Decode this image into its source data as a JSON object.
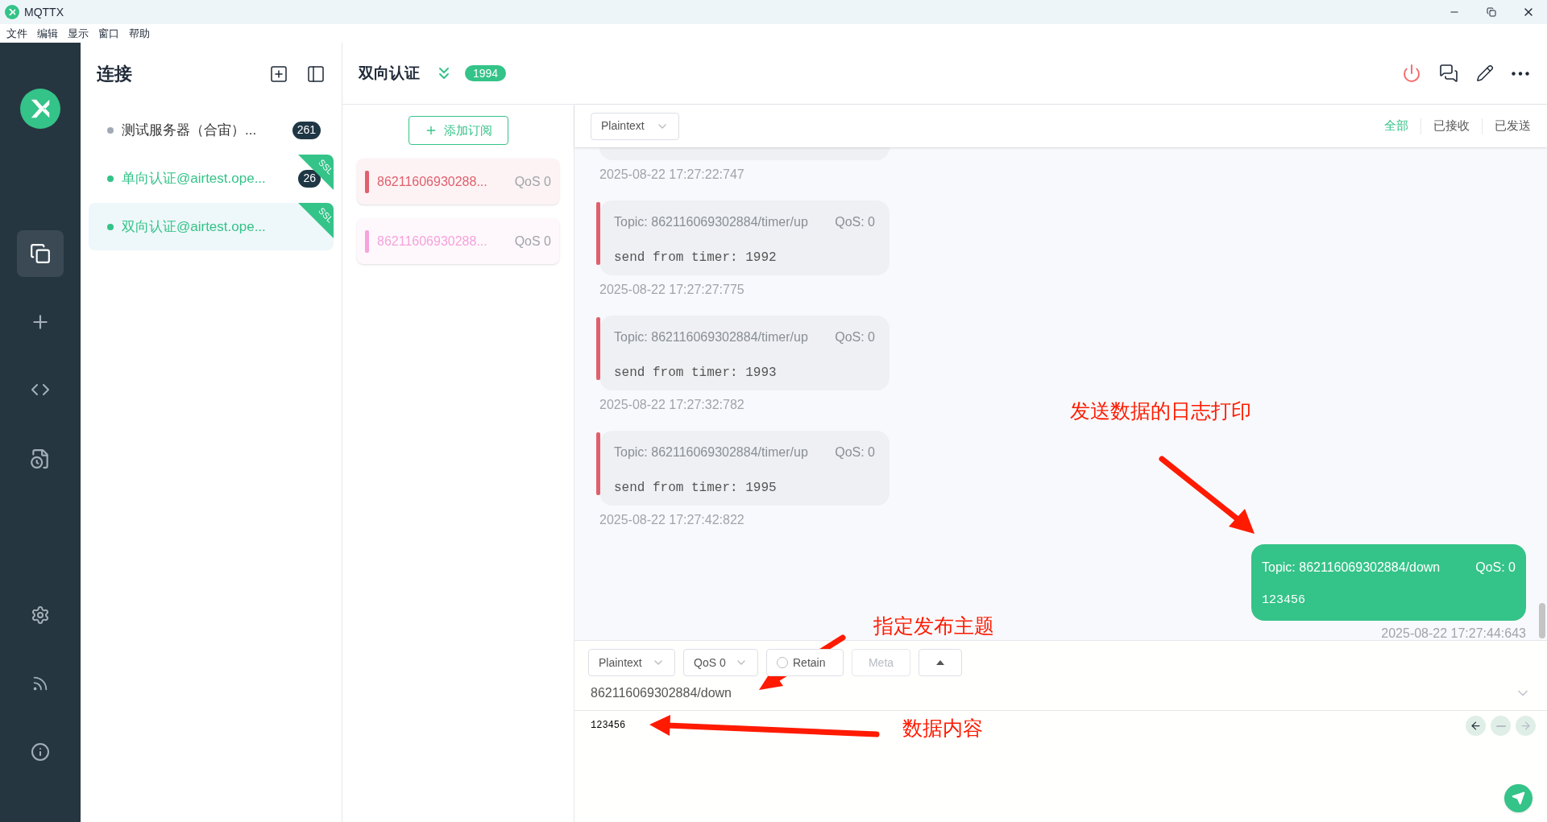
{
  "window": {
    "title": "MQTTX"
  },
  "menu": [
    "文件",
    "编辑",
    "显示",
    "窗口",
    "帮助"
  ],
  "connections_panel": {
    "title": "连接",
    "items": [
      {
        "name": "测试服务器（合宙）...",
        "connected": false,
        "count": "261",
        "selected": false
      },
      {
        "name": "单向认证@airtest.ope...",
        "connected": true,
        "count": "26",
        "ssl": "SSL",
        "selected": false
      },
      {
        "name": "双向认证@airtest.ope...",
        "connected": true,
        "ssl": "SSL",
        "selected": true
      }
    ]
  },
  "header": {
    "title": "双向认证",
    "count": "1994"
  },
  "subscriptions": {
    "add_button": "添加订阅",
    "items": [
      {
        "topic": "86211606930288...",
        "qos": "QoS 0",
        "color": "#e0606e"
      },
      {
        "topic": "86211606930288...",
        "qos": "QoS 0",
        "color": "#f5a3dc"
      }
    ]
  },
  "message_toolbar": {
    "format": "Plaintext",
    "filters": [
      {
        "label": "全部",
        "selected": true
      },
      {
        "label": "已接收",
        "selected": false
      },
      {
        "label": "已发送",
        "selected": false
      }
    ]
  },
  "messages": [
    {
      "kind": "cut",
      "time": "2025-08-22 17:27:22:747"
    },
    {
      "kind": "received",
      "topic": "Topic: 862116069302884/timer/up",
      "qos": "QoS: 0",
      "payload": "send from timer: 1992",
      "time": "2025-08-22 17:27:27:775"
    },
    {
      "kind": "received",
      "topic": "Topic: 862116069302884/timer/up",
      "qos": "QoS: 0",
      "payload": "send from timer: 1993",
      "time": "2025-08-22 17:27:32:782"
    },
    {
      "kind": "received",
      "topic": "Topic: 862116069302884/timer/up",
      "qos": "QoS: 0",
      "payload": "send from timer: 1995",
      "time": "2025-08-22 17:27:42:822"
    },
    {
      "kind": "sent",
      "topic": "Topic: 862116069302884/down",
      "qos": "QoS: 0",
      "payload": "123456",
      "time": "2025-08-22 17:27:44:643"
    }
  ],
  "publish": {
    "format": "Plaintext",
    "qos": "QoS 0",
    "retain": {
      "label": "Retain",
      "checked": false
    },
    "meta": "Meta",
    "topic": "862116069302884/down",
    "payload": "123456"
  },
  "annotations": [
    "发送数据的日志打印",
    "指定发布主题",
    "数据内容"
  ]
}
